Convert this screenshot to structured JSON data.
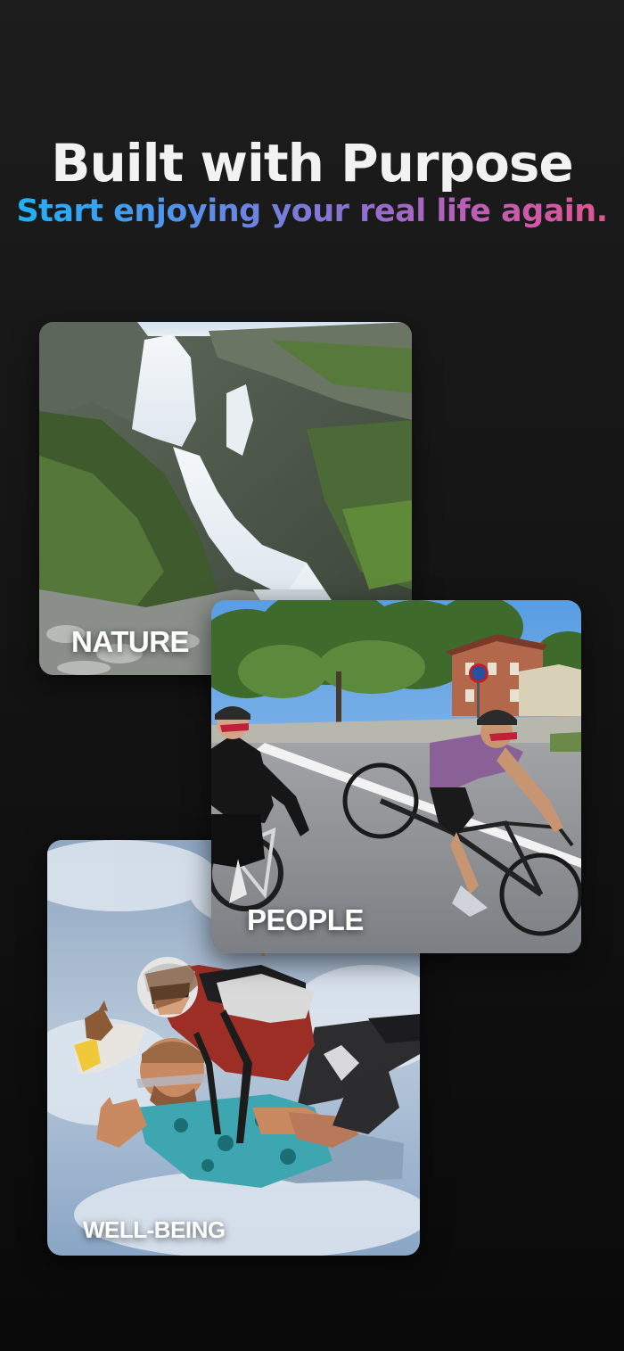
{
  "header": {
    "title": "Built with Purpose",
    "subtitle": "Start enjoying your real life again."
  },
  "cards": {
    "nature": {
      "label": "NATURE",
      "image": "waterfall-photo"
    },
    "people": {
      "label": "PEOPLE",
      "image": "cyclists-photo"
    },
    "wellbeing": {
      "label": "WELL-BEING",
      "image": "skydiving-photo"
    }
  },
  "colors": {
    "background": "#141414",
    "title": "#f2f2f2",
    "gradient_start": "#1fb1f7",
    "gradient_mid": "#8f6fd0",
    "gradient_end": "#e0558f"
  }
}
